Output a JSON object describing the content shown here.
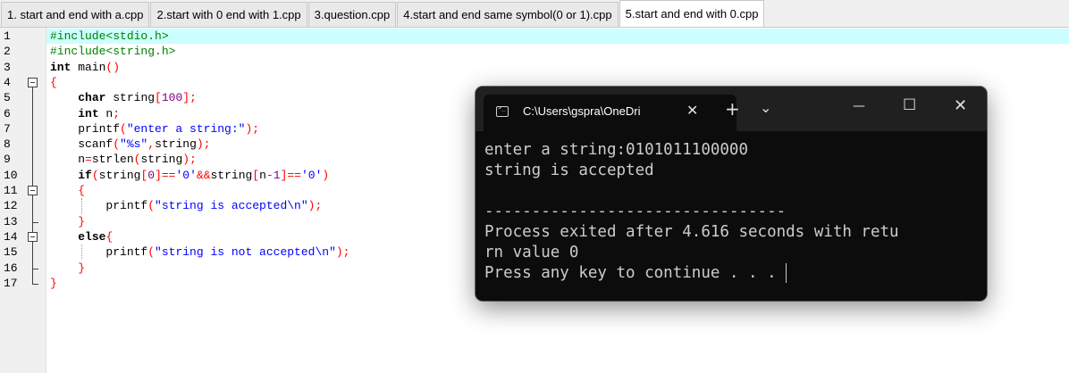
{
  "tabs": [
    {
      "label": "1. start and end with a.cpp",
      "active": false
    },
    {
      "label": "2.start with 0 end with 1.cpp",
      "active": false
    },
    {
      "label": "3.question.cpp",
      "active": false
    },
    {
      "label": "4.start and end same symbol(0 or 1).cpp",
      "active": false
    },
    {
      "label": "5.start and end with 0.cpp",
      "active": true
    }
  ],
  "editor": {
    "line_numbers": [
      "1",
      "2",
      "3",
      "4",
      "5",
      "6",
      "7",
      "8",
      "9",
      "10",
      "11",
      "12",
      "13",
      "14",
      "15",
      "16",
      "17"
    ],
    "current_line": 1,
    "code": [
      [
        {
          "c": "pp",
          "t": "#include<stdio.h>"
        }
      ],
      [
        {
          "c": "pp",
          "t": "#include<string.h>"
        }
      ],
      [
        {
          "c": "kw",
          "t": "int"
        },
        {
          "c": "txt",
          "t": " main"
        },
        {
          "c": "sym",
          "t": "()"
        }
      ],
      [
        {
          "c": "sym",
          "t": "{"
        }
      ],
      [
        {
          "c": "txt",
          "t": "    "
        },
        {
          "c": "kw",
          "t": "char"
        },
        {
          "c": "txt",
          "t": " string"
        },
        {
          "c": "sym",
          "t": "["
        },
        {
          "c": "num",
          "t": "100"
        },
        {
          "c": "sym",
          "t": "];"
        }
      ],
      [
        {
          "c": "txt",
          "t": "    "
        },
        {
          "c": "kw",
          "t": "int"
        },
        {
          "c": "txt",
          "t": " n"
        },
        {
          "c": "sym",
          "t": ";"
        }
      ],
      [
        {
          "c": "txt",
          "t": "    printf"
        },
        {
          "c": "sym",
          "t": "("
        },
        {
          "c": "str",
          "t": "\"enter a string:\""
        },
        {
          "c": "sym",
          "t": ");"
        }
      ],
      [
        {
          "c": "txt",
          "t": "    scanf"
        },
        {
          "c": "sym",
          "t": "("
        },
        {
          "c": "str",
          "t": "\"%s\""
        },
        {
          "c": "sym",
          "t": ","
        },
        {
          "c": "txt",
          "t": "string"
        },
        {
          "c": "sym",
          "t": ");"
        }
      ],
      [
        {
          "c": "txt",
          "t": "    n"
        },
        {
          "c": "sym",
          "t": "="
        },
        {
          "c": "txt",
          "t": "strlen"
        },
        {
          "c": "sym",
          "t": "("
        },
        {
          "c": "txt",
          "t": "string"
        },
        {
          "c": "sym",
          "t": ");"
        }
      ],
      [
        {
          "c": "txt",
          "t": "    "
        },
        {
          "c": "kw",
          "t": "if"
        },
        {
          "c": "sym",
          "t": "("
        },
        {
          "c": "txt",
          "t": "string"
        },
        {
          "c": "sym",
          "t": "["
        },
        {
          "c": "num",
          "t": "0"
        },
        {
          "c": "sym",
          "t": "]=="
        },
        {
          "c": "str",
          "t": "'0'"
        },
        {
          "c": "sym",
          "t": "&&"
        },
        {
          "c": "txt",
          "t": "string"
        },
        {
          "c": "sym",
          "t": "["
        },
        {
          "c": "txt",
          "t": "n"
        },
        {
          "c": "sym",
          "t": "-"
        },
        {
          "c": "num",
          "t": "1"
        },
        {
          "c": "sym",
          "t": "]=="
        },
        {
          "c": "str",
          "t": "'0'"
        },
        {
          "c": "sym",
          "t": ")"
        }
      ],
      [
        {
          "c": "txt",
          "t": "    "
        },
        {
          "c": "sym",
          "t": "{"
        }
      ],
      [
        {
          "c": "txt",
          "t": "        printf"
        },
        {
          "c": "sym",
          "t": "("
        },
        {
          "c": "str",
          "t": "\"string is accepted\\n\""
        },
        {
          "c": "sym",
          "t": ");"
        }
      ],
      [
        {
          "c": "txt",
          "t": "    "
        },
        {
          "c": "sym",
          "t": "}"
        }
      ],
      [
        {
          "c": "txt",
          "t": "    "
        },
        {
          "c": "kw",
          "t": "else"
        },
        {
          "c": "sym",
          "t": "{"
        }
      ],
      [
        {
          "c": "txt",
          "t": "        printf"
        },
        {
          "c": "sym",
          "t": "("
        },
        {
          "c": "str",
          "t": "\"string is not accepted\\n\""
        },
        {
          "c": "sym",
          "t": ");"
        }
      ],
      [
        {
          "c": "txt",
          "t": "    "
        },
        {
          "c": "sym",
          "t": "}"
        }
      ],
      [
        {
          "c": "sym",
          "t": "}"
        }
      ]
    ]
  },
  "console": {
    "tab_title": "C:\\Users\\gspra\\OneDri",
    "tab_close": "✕",
    "new_tab": "+",
    "dropdown": "⌄",
    "minimize": "—",
    "maximize": "☐",
    "close": "✕",
    "output_lines": [
      "enter a string:0101011100000",
      "string is accepted",
      "",
      "--------------------------------",
      "Process exited after 4.616 seconds with retu",
      "rn value 0",
      "Press any key to continue . . . "
    ]
  },
  "colors": {
    "current_line": "#ccffff",
    "preprocessor": "#008000",
    "symbol": "#ff0000",
    "string": "#0000ff",
    "number": "#800080",
    "console_bg": "#0c0c0c",
    "console_titlebar": "#202020",
    "console_text": "#cccccc"
  }
}
